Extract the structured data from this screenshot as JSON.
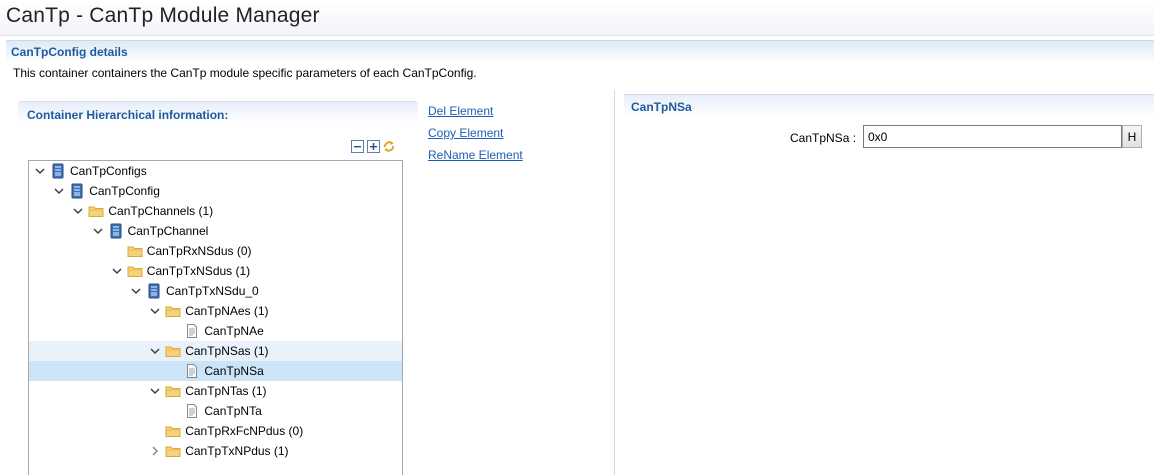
{
  "window": {
    "title": "CanTp - CanTp Module Manager"
  },
  "section": {
    "title": "CanTpConfig details",
    "description": "This container containers the CanTp module specific parameters of each CanTpConfig."
  },
  "hierarchy": {
    "title": "Container Hierarchical information:"
  },
  "actions": {
    "del": "Del Element",
    "copy": "Copy Element",
    "rename": "ReName Element"
  },
  "tree": [
    {
      "label": "CanTpConfigs",
      "depth": 0,
      "icon": "module-icon",
      "state": "expanded"
    },
    {
      "label": "CanTpConfig",
      "depth": 1,
      "icon": "module-icon",
      "state": "expanded"
    },
    {
      "label": "CanTpChannels (1)",
      "depth": 2,
      "icon": "folder-icon",
      "state": "expanded"
    },
    {
      "label": "CanTpChannel",
      "depth": 3,
      "icon": "module-icon",
      "state": "expanded"
    },
    {
      "label": "CanTpRxNSdus (0)",
      "depth": 4,
      "icon": "folder-icon",
      "state": "none"
    },
    {
      "label": "CanTpTxNSdus (1)",
      "depth": 4,
      "icon": "folder-icon",
      "state": "expanded"
    },
    {
      "label": "CanTpTxNSdu_0",
      "depth": 5,
      "icon": "module-icon",
      "state": "expanded"
    },
    {
      "label": "CanTpNAes (1)",
      "depth": 6,
      "icon": "folder-icon",
      "state": "expanded"
    },
    {
      "label": "CanTpNAe",
      "depth": 7,
      "icon": "file-icon",
      "state": "none"
    },
    {
      "label": "CanTpNSas (1)",
      "depth": 6,
      "icon": "folder-icon",
      "state": "expanded",
      "highlight": "hover"
    },
    {
      "label": "CanTpNSa",
      "depth": 7,
      "icon": "file-icon",
      "state": "none",
      "highlight": "selected"
    },
    {
      "label": "CanTpNTas (1)",
      "depth": 6,
      "icon": "folder-icon",
      "state": "expanded"
    },
    {
      "label": "CanTpNTa",
      "depth": 7,
      "icon": "file-icon",
      "state": "none"
    },
    {
      "label": "CanTpRxFcNPdus (0)",
      "depth": 6,
      "icon": "folder-icon",
      "state": "none"
    },
    {
      "label": "CanTpTxNPdus (1)",
      "depth": 6,
      "icon": "folder-icon",
      "state": "collapsed"
    }
  ],
  "param_panel": {
    "title": "CanTpNSa",
    "label": "CanTpNSa :",
    "value": "0x0",
    "button_label": "H"
  },
  "colors": {
    "accent": "#1f5a9e",
    "link": "#1a5fb4",
    "selected": "#cce4f7",
    "hover": "#e9f2fb"
  }
}
